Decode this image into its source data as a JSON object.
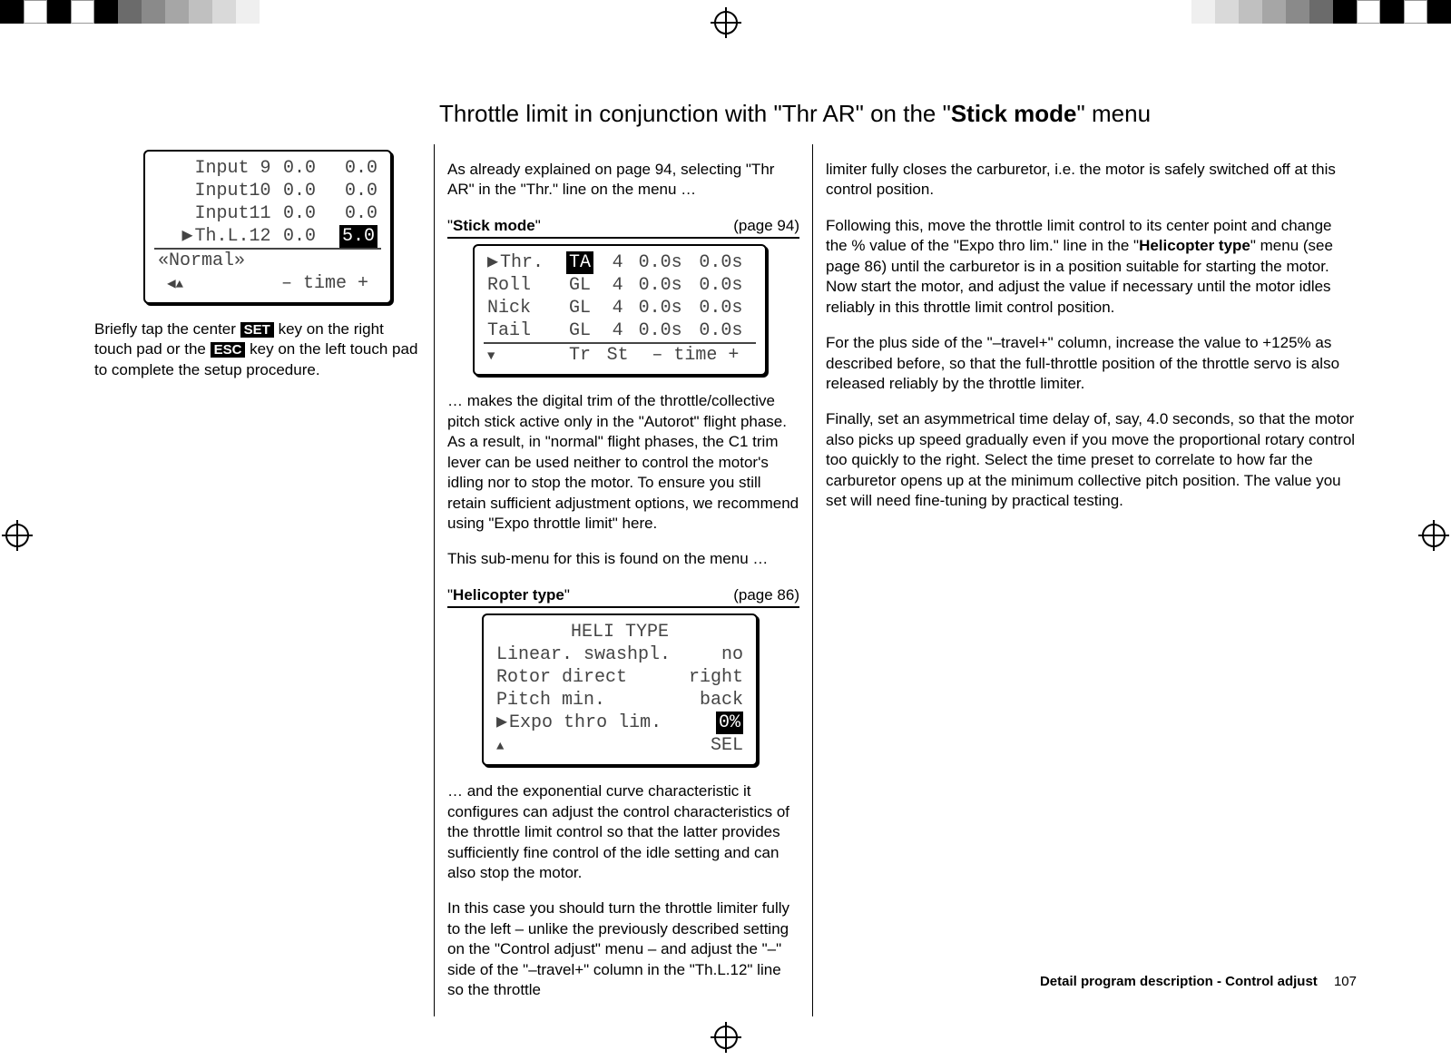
{
  "title_pre": "Throttle limit in conjunction with \"Thr AR\" on the \"",
  "title_bold": "Stick mode",
  "title_post": "\" menu",
  "col1": {
    "lcd": {
      "rows": [
        {
          "label": "Input  9",
          "v1": "0.0",
          "v2": "0.0",
          "ptr": false,
          "hl": false
        },
        {
          "label": "Input10",
          "v1": "0.0",
          "v2": "0.0",
          "ptr": false,
          "hl": false
        },
        {
          "label": "Input11",
          "v1": "0.0",
          "v2": "0.0",
          "ptr": false,
          "hl": false
        },
        {
          "label": "Th.L.12",
          "v1": "0.0",
          "v2": "5.0",
          "ptr": true,
          "hl": true
        }
      ],
      "phase": "«Normal»",
      "foot": "– time +"
    },
    "para_before_set": "Briefly tap the center ",
    "key_set": "SET",
    "para_mid": " key on the right touch pad or the ",
    "key_esc": "ESC",
    "para_after": " key on the left touch pad to complete the setup procedure."
  },
  "col2": {
    "p1": "As already explained on page 94, selecting \"Thr AR\" in the \"Thr.\" line on the menu …",
    "menu1_label_pre": "\"",
    "menu1_label_bold": "Stick mode",
    "menu1_label_post": "\"",
    "menu1_ref": "(page 94)",
    "lcd2": {
      "rows": [
        {
          "label": "Thr.",
          "c2": "TA",
          "c3": "4",
          "c4": "0.0s",
          "c5": "0.0s",
          "ptr": true,
          "hl": true
        },
        {
          "label": "Roll",
          "c2": "GL",
          "c3": "4",
          "c4": "0.0s",
          "c5": "0.0s",
          "ptr": false,
          "hl": false
        },
        {
          "label": "Nick",
          "c2": "GL",
          "c3": "4",
          "c4": "0.0s",
          "c5": "0.0s",
          "ptr": false,
          "hl": false
        },
        {
          "label": "Tail",
          "c2": "GL",
          "c3": "4",
          "c4": "0.0s",
          "c5": "0.0s",
          "ptr": false,
          "hl": false
        }
      ],
      "foot_cols": [
        "Tr",
        "St",
        "– time +"
      ]
    },
    "p2": "… makes the digital trim of the throttle/collective pitch stick active only in the \"Autorot\" flight phase. As a result, in \"normal\" flight phases, the C1 trim lever can be used neither to control the motor's idling nor to stop the motor. To ensure you still retain sufficient adjustment options, we recommend using \"Expo throttle limit\" here.",
    "p3": "This sub-menu for this is found on the menu …",
    "menu2_label_pre": "\"",
    "menu2_label_bold": "Helicopter type",
    "menu2_label_post": "\"",
    "menu2_ref": "(page 86)",
    "lcd3": {
      "title": "HELI  TYPE",
      "rows": [
        {
          "label": "Linear. swashpl.",
          "val": "no",
          "ptr": false,
          "hl": false
        },
        {
          "label": "Rotor direct",
          "val": "right",
          "ptr": false,
          "hl": false
        },
        {
          "label": "Pitch min.",
          "val": "back",
          "ptr": false,
          "hl": false
        },
        {
          "label": "Expo thro lim.",
          "val": "0%",
          "ptr": true,
          "hl": true
        }
      ],
      "foot_right": "SEL"
    },
    "p4": "… and the exponential curve characteristic it configures can adjust the control characteristics of the throttle limit control so that the latter provides sufficiently fine control of the idle setting and can also stop the motor.",
    "p5": "In this case you should turn the throttle limiter fully to the left – unlike the previously described setting on the \"Control adjust\" menu – and adjust the \"–\" side of the \"–travel+\" column in the \"Th.L.12\" line so the throttle"
  },
  "col3": {
    "p1": "limiter fully closes the carburetor, i.e. the motor is safely switched off at this control position.",
    "p2_a": "Following this, move the throttle limit control to its center point and change the % value of the \"Expo thro lim.\" line in the \"",
    "p2_bold": "Helicopter type",
    "p2_b": "\" menu (see page 86) until the carburetor is in a position suitable for starting the motor. Now start the motor, and adjust the value if necessary until the motor idles reliably in this throttle limit control position.",
    "p3": "For the plus side of the \"–travel+\" column, increase the value to +125% as described before, so that the full-throttle position of the throttle servo is also released reliably by the throttle limiter.",
    "p4": "Finally, set an asymmetrical time delay of, say, 4.0 seconds, so that the motor also picks up speed gradually even if you move the proportional rotary control too quickly to the right. Select the time preset to correlate to how far the carburetor opens up at the minimum collective pitch position. The value you set will need fine-tuning by practical testing."
  },
  "footer": {
    "section": "Detail program description - Control adjust",
    "page": "107"
  }
}
